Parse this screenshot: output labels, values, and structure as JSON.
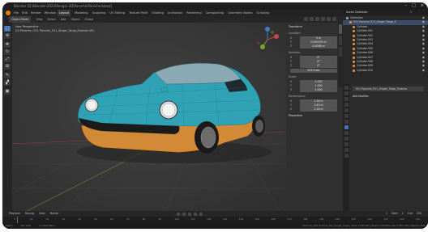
{
  "titlebar": {
    "title": "Blender [D:\\Blender-2023\\Rengin-3D\\Porsche\\Porsche.blend]"
  },
  "menubar": {
    "file_menus": [
      "File",
      "Edit",
      "Render",
      "Window",
      "Help"
    ],
    "workspace_tabs": [
      "Layout",
      "Modeling",
      "Sculpting",
      "UV Editing",
      "Texture Paint",
      "Shading",
      "Animation",
      "Rendering",
      "Compositing",
      "Geometry Nodes",
      "Scripting"
    ],
    "active_tab": "Layout",
    "scene_label": "Scene",
    "layer_label": "ViewLayer"
  },
  "viewport_header": {
    "mode": "Object Mode",
    "menus": [
      "View",
      "Select",
      "Add",
      "Object"
    ],
    "transform": "Global"
  },
  "viewport": {
    "view_name": "User Perspective",
    "collection_info": "(0) Porsche | 911 Porsche_911_Singer_Targa_Exterior.001"
  },
  "npanel": {
    "title": "Transform",
    "location_label": "Location:",
    "location": {
      "X": "0 m",
      "Y": "0.000035 m",
      "Z": "0.0068 m"
    },
    "rotation_label": "Rotation:",
    "rotation": {
      "X": "0°",
      "Y": "0°",
      "Z": "0°"
    },
    "mode_label": "XYZ Euler",
    "scale_label": "Scale:",
    "scale": {
      "X": "1.000",
      "Y": "1.000",
      "Z": "1.000"
    },
    "dimensions_label": "Dimensions:",
    "dimensions": {
      "X": "1.38 m",
      "Y": "1.83 m",
      "Z": "2.18 m"
    },
    "properties_label": "Properties"
  },
  "outliner": {
    "header": "Scene Collection",
    "rows": [
      {
        "name": "Collection",
        "color": "#7ca9d6",
        "selected": false
      },
      {
        "name": "911 Porsche_911_Singer_Targa_E",
        "color": "#e28c3e",
        "selected": true
      },
      {
        "name": "Cylinder",
        "color": "#e28c3e",
        "selected": false
      },
      {
        "name": "Cylinder.001",
        "color": "#e28c3e",
        "selected": false
      },
      {
        "name": "Cylinder.002",
        "color": "#e28c3e",
        "selected": false
      },
      {
        "name": "Cylinder.003",
        "color": "#e28c3e",
        "selected": false
      },
      {
        "name": "Cylinder.004",
        "color": "#e28c3e",
        "selected": false
      },
      {
        "name": "Cylinder.005",
        "color": "#e28c3e",
        "selected": false
      },
      {
        "name": "Cylinder.006",
        "color": "#e28c3e",
        "selected": false
      },
      {
        "name": "Cylinder.007",
        "color": "#e28c3e",
        "selected": false
      },
      {
        "name": "Cylinder.008",
        "color": "#e28c3e",
        "selected": false
      },
      {
        "name": "Cylinder.009",
        "color": "#e28c3e",
        "selected": false
      },
      {
        "name": "Cylinder.010",
        "color": "#e28c3e",
        "selected": false
      }
    ]
  },
  "properties": {
    "object_name": "911 Porsche_911_Singer_Targa_Exterior",
    "add_modifier": "Add Modifier"
  },
  "timeline": {
    "menus": [
      "Playback",
      "Keying",
      "View",
      "Marker"
    ],
    "start_label": "Start",
    "start": "1",
    "end_label": "End",
    "end": "250",
    "current": "1",
    "ticks": [
      "0",
      "10",
      "20",
      "30",
      "40",
      "50",
      "60",
      "70",
      "80",
      "90",
      "100",
      "110",
      "120",
      "130",
      "140",
      "150",
      "160",
      "170",
      "180",
      "190",
      "200",
      "210",
      "220",
      "230",
      "240",
      "250"
    ]
  },
  "statusbar": {
    "hints": [
      "Select",
      "Pan View",
      "Context Menu"
    ],
    "stats": "Porsche | 911 Porsche_911_Singer_Targa | Verts 1,230,443 | Faces 1,250,005 | Tris 2,487,190 | Objects 1/64"
  },
  "colors": {
    "car_body": "#2fa2b6",
    "car_lower": "#d38a37",
    "selection_outline": "#e8861a",
    "active_blue": "#4772b3",
    "blender_orange": "#e87d0d"
  }
}
